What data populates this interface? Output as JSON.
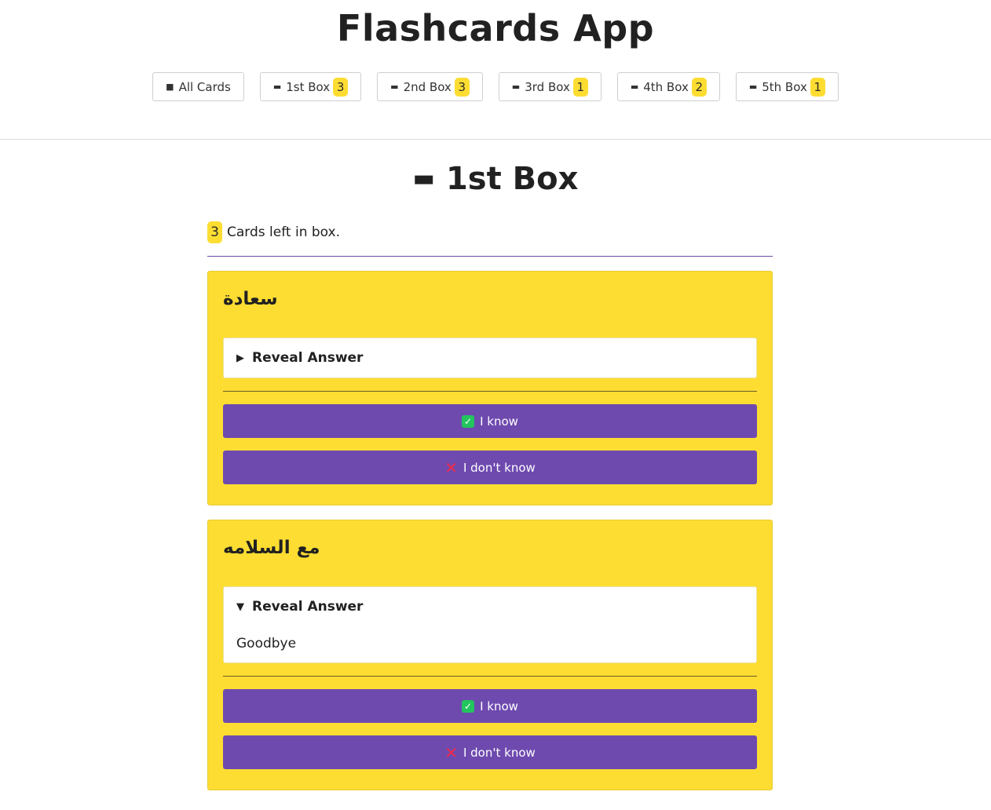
{
  "app": {
    "title": "Flashcards App"
  },
  "nav": {
    "items": [
      {
        "label": "All Cards",
        "count": null,
        "icon": "all-cards-icon"
      },
      {
        "label": "1st Box",
        "count": "3",
        "icon": "card-box-icon"
      },
      {
        "label": "2nd Box",
        "count": "3",
        "icon": "card-box-icon"
      },
      {
        "label": "3rd Box",
        "count": "1",
        "icon": "card-box-icon"
      },
      {
        "label": "4th Box",
        "count": "2",
        "icon": "card-box-icon"
      },
      {
        "label": "5th Box",
        "count": "1",
        "icon": "card-box-icon"
      }
    ]
  },
  "box": {
    "title": "1st Box",
    "cards_left_count": "3",
    "cards_left_text": "Cards left in box."
  },
  "cards": [
    {
      "word": "سعادة",
      "reveal_label": "Reveal Answer",
      "expanded": false,
      "answer": "",
      "know_label": "I know",
      "dont_know_label": "I don't know"
    },
    {
      "word": "مع السلامه",
      "reveal_label": "Reveal Answer",
      "expanded": true,
      "answer": "Goodbye",
      "know_label": "I know",
      "dont_know_label": "I don't know"
    }
  ],
  "colors": {
    "accent": "#6e4aaf",
    "card": "#fddd32",
    "badge": "#fddd32"
  }
}
